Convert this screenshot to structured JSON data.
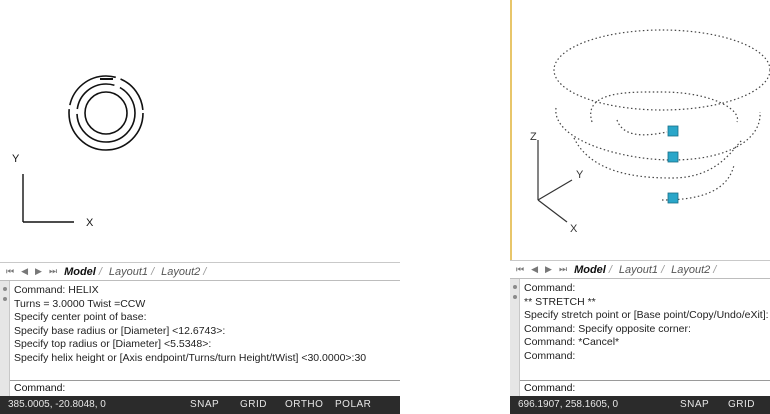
{
  "left": {
    "axis": {
      "y_label": "Y",
      "x_label": "X"
    },
    "tabs": {
      "nav": [
        "⏮",
        "◀",
        "▶",
        "⏭"
      ],
      "items": [
        "Model",
        "Layout1",
        "Layout2"
      ]
    },
    "command_history": [
      "Command: HELIX",
      "Turns = 3.0000 Twist =CCW",
      "Specify center point of base:",
      "Specify base radius or [Diameter] <12.6743>:",
      "Specify top radius or [Diameter] <5.5348>:",
      "Specify helix height or [Axis endpoint/Turns/turn Height/tWist] <30.0000>:30"
    ],
    "command_prompt": "Command:",
    "status": {
      "coords": "385.0005, -20.8048, 0",
      "buttons": [
        "SNAP",
        "GRID",
        "ORTHO",
        "POLAR"
      ]
    }
  },
  "right": {
    "axis": {
      "z_label": "Z",
      "y_label": "Y",
      "x_label": "X"
    },
    "tabs": {
      "nav": [
        "⏮",
        "◀",
        "▶",
        "⏭"
      ],
      "items": [
        "Model",
        "Layout1",
        "Layout2"
      ]
    },
    "command_history": [
      "Command:",
      "** STRETCH **",
      "Specify stretch point or [Base point/Copy/Undo/eXit]:",
      "Command: Specify opposite corner:",
      "Command: *Cancel*",
      "Command:"
    ],
    "command_prompt": "Command:",
    "status": {
      "coords": "696.1907, 258.1605, 0",
      "buttons": [
        "SNAP",
        "GRID"
      ]
    }
  },
  "colors": {
    "grip": "#2aa6c9",
    "statusbar": "#2b2b2b",
    "viewport_border": "#e8c66a"
  }
}
